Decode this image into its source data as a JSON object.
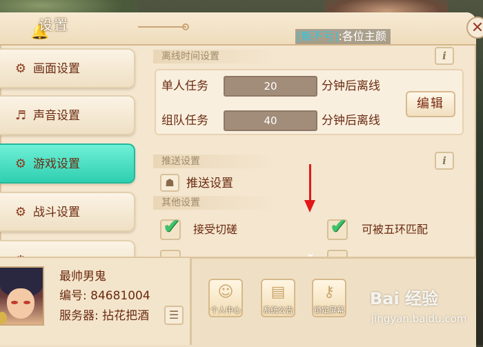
{
  "window": {
    "title": "设置",
    "close_glyph": "✕"
  },
  "notice": {
    "name": "[甒不亏]",
    "separator": ":",
    "message": "各位主颜"
  },
  "sidebar": {
    "items": [
      {
        "label": "画面设置",
        "icon": "display-settings-icon",
        "active": false
      },
      {
        "label": "声音设置",
        "icon": "music-note-icon",
        "active": false
      },
      {
        "label": "游戏设置",
        "icon": "gear-icon",
        "active": true
      },
      {
        "label": "战斗设置",
        "icon": "battle-gear-icon",
        "active": false
      },
      {
        "label": "",
        "icon": "gear-icon",
        "active": false
      }
    ]
  },
  "offline": {
    "header": "离线时间设置",
    "rows": [
      {
        "label": "单人任务",
        "value": "20",
        "suffix": "分钟后离线"
      },
      {
        "label": "组队任务",
        "value": "40",
        "suffix": "分钟后离线"
      }
    ],
    "edit_label": "编辑"
  },
  "push": {
    "header": "推送设置",
    "button_label": "推送设置"
  },
  "other": {
    "header": "其他设置",
    "options": [
      {
        "label": "接受切磋",
        "checked": true
      },
      {
        "label": "可被五环匹配",
        "checked": true
      }
    ]
  },
  "profile": {
    "name": "最帅男鬼",
    "id_label": "编号:",
    "id_value": "84681004",
    "server_label": "服务器:",
    "server_value": "拈花把酒"
  },
  "bottom_buttons": [
    {
      "label": "个人中心",
      "icon": "person-icon"
    },
    {
      "label": "系统公告",
      "icon": "scroll-icon"
    },
    {
      "label": "锁定屏幕",
      "icon": "key-icon"
    }
  ],
  "watermark": {
    "logo": "Bai 经验",
    "url": "jingyan.baidu.com"
  },
  "colors": {
    "active_tab": "#2fcfb1",
    "text_dark_red": "#6a2a10",
    "check_green": "#3cc46a",
    "annotation_red": "#e01818",
    "notice_name": "#34c6d9"
  }
}
